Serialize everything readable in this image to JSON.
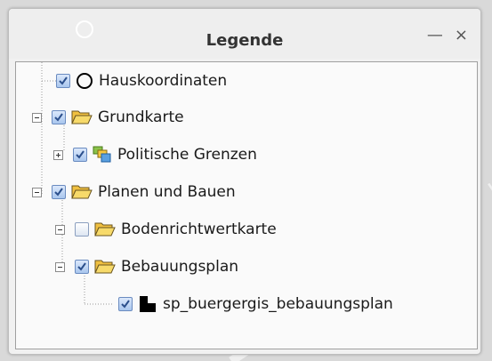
{
  "window": {
    "title": "Legende"
  },
  "tools": {
    "minimize": "—",
    "close": "×"
  },
  "tree": [
    {
      "label": "Hauskoordinaten",
      "checked": true,
      "icon": "circle-icon"
    },
    {
      "label": "Grundkarte",
      "checked": true,
      "icon": "folder-open-icon",
      "expanded": true
    },
    {
      "label": "Politische Grenzen",
      "checked": true,
      "icon": "layers-icon",
      "expanded": false
    },
    {
      "label": "Planen und Bauen",
      "checked": true,
      "icon": "folder-open-icon",
      "expanded": true
    },
    {
      "label": "Bodenrichtwertkarte",
      "checked": false,
      "icon": "folder-open-icon",
      "expanded": true
    },
    {
      "label": "Bebauungsplan",
      "checked": true,
      "icon": "folder-open-icon",
      "expanded": true
    },
    {
      "label": "sp_buergergis_bebauungsplan",
      "checked": true,
      "icon": "polygon-legend-icon"
    }
  ]
}
